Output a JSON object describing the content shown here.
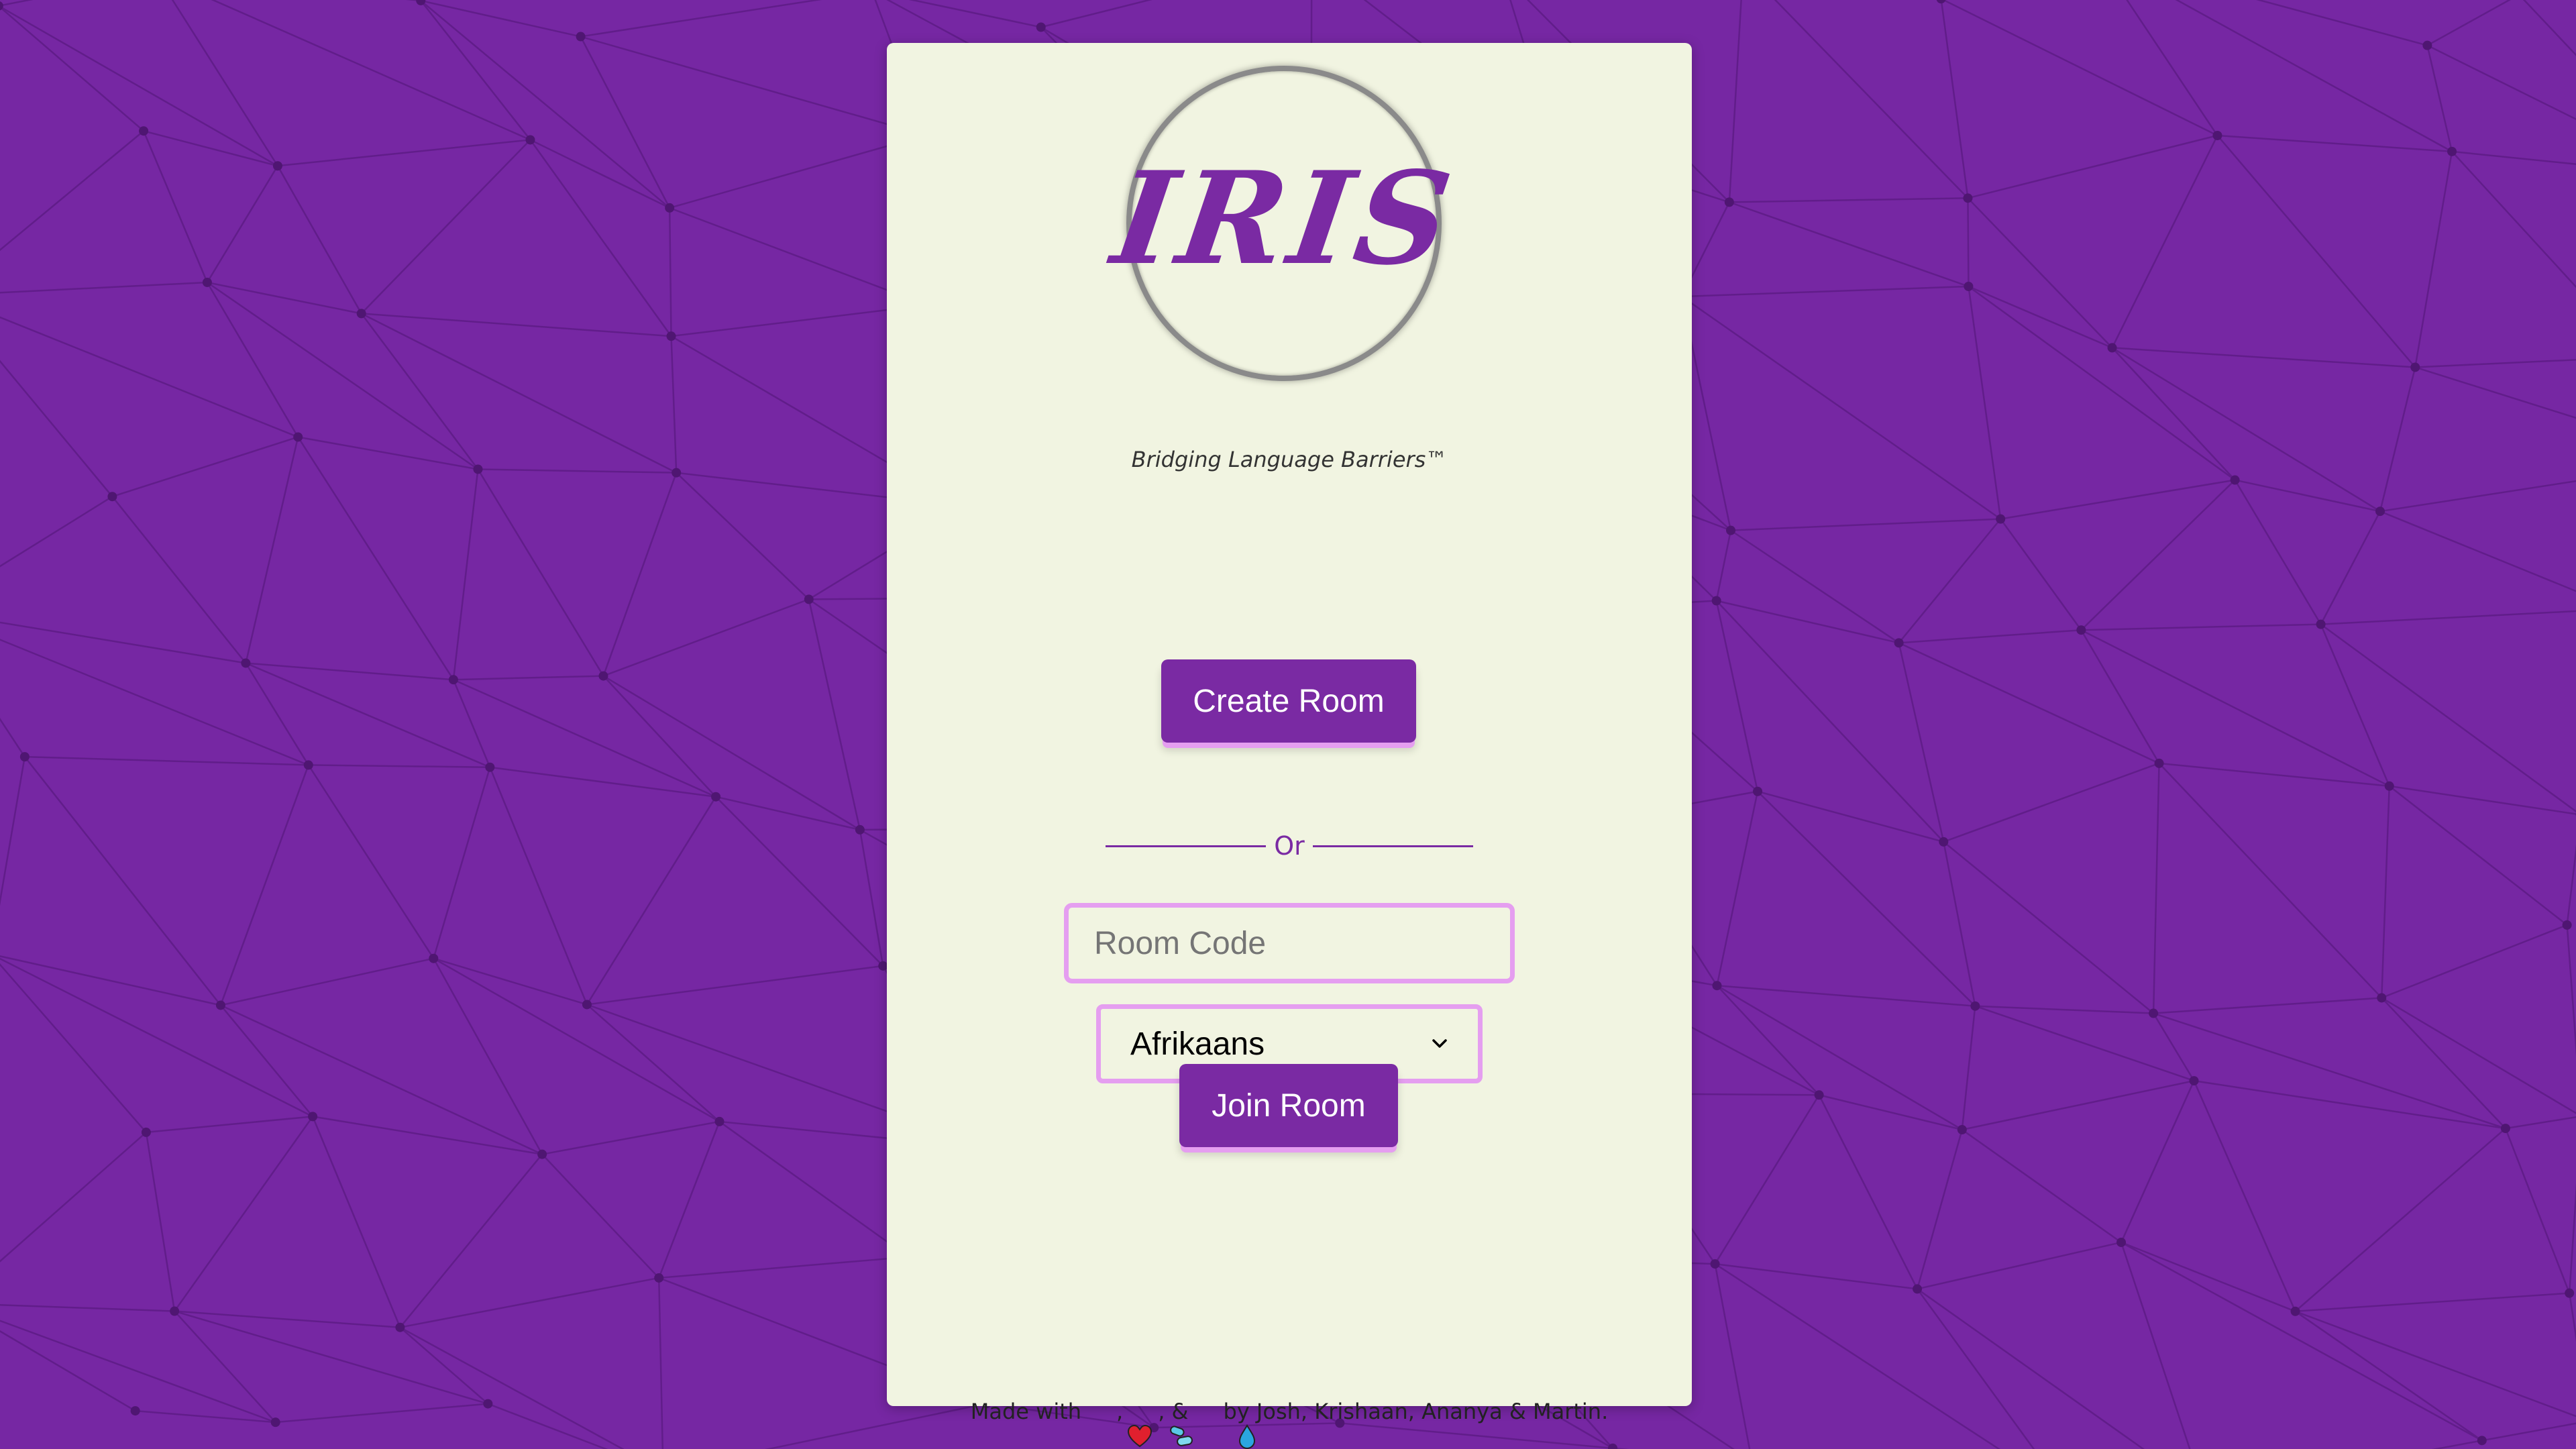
{
  "app": {
    "logo_text": "IRIS",
    "tagline": "Bridging Language Barriers™"
  },
  "actions": {
    "create_room_label": "Create Room",
    "divider_text": "Or",
    "room_code_placeholder": "Room Code",
    "room_code_value": "",
    "language_selected": "Afrikaans",
    "join_room_label": "Join Room"
  },
  "footer": {
    "prefix": "Made with",
    "sep1": ",",
    "sep2": ", &",
    "suffix": "by Josh, Krishaan, Ananya & Martin.",
    "icons": [
      "heart-icon",
      "pills-icon",
      "droplet-icon"
    ]
  },
  "colors": {
    "background": "#7627a3",
    "card": "#f1f4e1",
    "accent": "#7a2aa3",
    "accent_light": "#e59ef0"
  }
}
